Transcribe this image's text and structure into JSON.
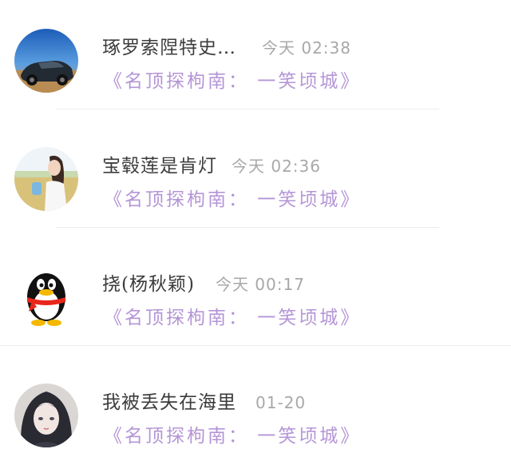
{
  "conversations": [
    {
      "name": "琢罗索陧特史…",
      "time": "今天 02:38",
      "message": "《名顶探枸南： 一笑顷城》",
      "avatar": "sports-car-photo"
    },
    {
      "name": "宝毂莲是肯灯",
      "time": "今天 02:36",
      "message": "《名顶探枸南： 一笑顷城》",
      "avatar": "girl-field-photo"
    },
    {
      "name": "挠(杨秋颖)",
      "time": "今天 00:17",
      "message": "《名顶探枸南： 一笑顷城》",
      "avatar": "qq-penguin"
    },
    {
      "name": "我被丢失在海里",
      "time": "01-20",
      "message": "《名顶探枸南： 一笑顷城》",
      "avatar": "anime-girl-portrait"
    }
  ],
  "colors": {
    "message": "#b495d6",
    "name": "#3c3c3c",
    "time": "#a8a8a8",
    "divider": "#ececec"
  }
}
